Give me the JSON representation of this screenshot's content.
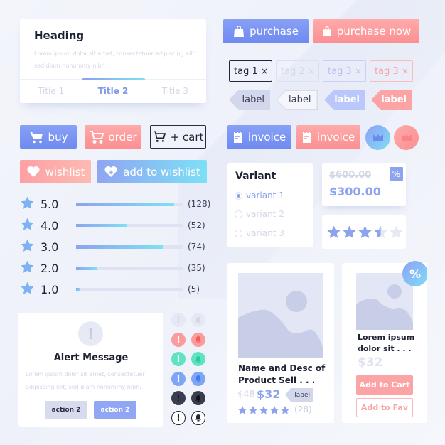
{
  "heading_card": {
    "title": "Heading",
    "body": "Lorem ipsum dolor sit amet, consectetuer adipiscing elit, sed diam nonummy nibh",
    "tabs": [
      {
        "label": "Title 1",
        "active": false
      },
      {
        "label": "Title 2",
        "active": true
      },
      {
        "label": "Title 3",
        "active": false
      }
    ]
  },
  "purchase_buttons": {
    "purchase": "purchase",
    "purchase_now": "purchase now"
  },
  "tags": [
    {
      "label": "tag 1",
      "close": "×",
      "style": "dark"
    },
    {
      "label": "tag 2",
      "close": "×",
      "style": "muted"
    },
    {
      "label": "tag 3",
      "close": "×",
      "style": "blue"
    },
    {
      "label": "tag 3",
      "close": "×",
      "style": "pink"
    }
  ],
  "labels": [
    {
      "text": "label",
      "style": "gray-filled"
    },
    {
      "text": "label",
      "style": "outline"
    },
    {
      "text": "label",
      "style": "blue-filled"
    },
    {
      "text": "label",
      "style": "pink-filled"
    }
  ],
  "cart_buttons": {
    "buy": "buy",
    "order": "order",
    "add_cart": "+ cart"
  },
  "wishlist_buttons": {
    "wishlist": "wishlist",
    "add_to_wishlist": "add to wishlist"
  },
  "invoice_buttons": {
    "invoice_blue": "invoice",
    "invoice_pink": "invoice"
  },
  "rating_breakdown": [
    {
      "rating": "5.0",
      "count": "(128)",
      "fill": 0.92
    },
    {
      "rating": "4.0",
      "count": "(52)",
      "fill": 0.48
    },
    {
      "rating": "3.0",
      "count": "(74)",
      "fill": 0.82
    },
    {
      "rating": "2.0",
      "count": "(35)",
      "fill": 0.2
    },
    {
      "rating": "1.0",
      "count": "(5)",
      "fill": 0.04
    }
  ],
  "variant": {
    "title": "Variant",
    "options": [
      {
        "label": "variant 1",
        "selected": true
      },
      {
        "label": "variant 2",
        "selected": false
      },
      {
        "label": "variant 3",
        "selected": false
      }
    ]
  },
  "price_card": {
    "old_price": "$600.00",
    "new_price": "$300.00",
    "badge": "%"
  },
  "star_rating": {
    "value": 3.5,
    "max": 5
  },
  "alert": {
    "icon": "!",
    "title": "Alert Message",
    "body": "Lorem ipsum dolor sit amet, consectetuer adipiscing elit, sed diam nonummy nibh.",
    "action_secondary": "action 2",
    "action_primary": "action 2"
  },
  "status_icons": [
    {
      "variant": "muted",
      "color": "#e6e8f3"
    },
    {
      "variant": "red",
      "color": "#fb9b9b"
    },
    {
      "variant": "green",
      "color": "#5fe3c0"
    },
    {
      "variant": "blue",
      "color": "#7fa6f5"
    },
    {
      "variant": "dark",
      "color": "#3a3d4d"
    },
    {
      "variant": "outline",
      "color": "#ffffff"
    }
  ],
  "product_card_1": {
    "name": "Name and Desc of Product Sell . . .",
    "old_price": "$48",
    "price": "$32",
    "label": "label",
    "rating": 5,
    "reviews": "(28)"
  },
  "product_card_2": {
    "name": "Lorem ipsum dolor sit . . .",
    "price": "$32",
    "badge": "%",
    "add_to_cart": "Add to Cart",
    "add_to_fav": "Add to Fav"
  },
  "colors": {
    "blue": "#7f96f2",
    "pink": "#fc999b",
    "light_blue_text": "#8ca3ef",
    "muted": "#d3d7e6"
  }
}
